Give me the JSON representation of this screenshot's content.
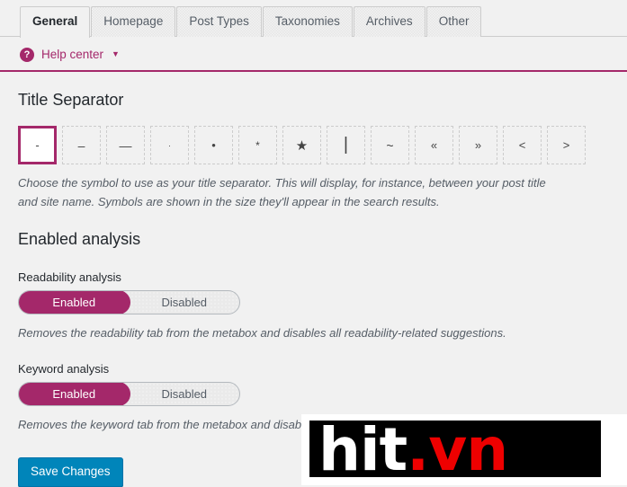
{
  "tabs": [
    {
      "label": "General",
      "active": true
    },
    {
      "label": "Homepage",
      "active": false
    },
    {
      "label": "Post Types",
      "active": false
    },
    {
      "label": "Taxonomies",
      "active": false
    },
    {
      "label": "Archives",
      "active": false
    },
    {
      "label": "Other",
      "active": false
    }
  ],
  "help": {
    "icon": "question-mark-circle-icon",
    "label": "Help center",
    "caret": "▼"
  },
  "title_separator": {
    "heading": "Title Separator",
    "options": [
      {
        "glyph": "-",
        "name": "hyphen",
        "class": "g-hyphen",
        "selected": true
      },
      {
        "glyph": "–",
        "name": "en-dash",
        "class": "g-endash",
        "selected": false
      },
      {
        "glyph": "—",
        "name": "em-dash",
        "class": "g-emdash",
        "selected": false
      },
      {
        "glyph": "·",
        "name": "middle-dot",
        "class": "g-dot",
        "selected": false
      },
      {
        "glyph": "•",
        "name": "bullet",
        "class": "g-bullet",
        "selected": false
      },
      {
        "glyph": "*",
        "name": "asterisk",
        "class": "g-star-sm",
        "selected": false
      },
      {
        "glyph": "★",
        "name": "star",
        "class": "g-star-lg",
        "selected": false
      },
      {
        "glyph": "|",
        "name": "pipe",
        "class": "g-pipe",
        "selected": false
      },
      {
        "glyph": "~",
        "name": "tilde",
        "class": "g-tilde",
        "selected": false
      },
      {
        "glyph": "«",
        "name": "double-angle-left",
        "class": "g-chev",
        "selected": false
      },
      {
        "glyph": "»",
        "name": "double-angle-right",
        "class": "g-chev",
        "selected": false
      },
      {
        "glyph": "<",
        "name": "less-than",
        "class": "g-chev",
        "selected": false
      },
      {
        "glyph": ">",
        "name": "greater-than",
        "class": "g-chev",
        "selected": false
      }
    ],
    "description": "Choose the symbol to use as your title separator. This will display, for instance, between your post title and site name. Symbols are shown in the size they'll appear in the search results."
  },
  "enabled_analysis": {
    "heading": "Enabled analysis",
    "readability": {
      "label": "Readability analysis",
      "on_label": "Enabled",
      "off_label": "Disabled",
      "value": "Enabled",
      "description": "Removes the readability tab from the metabox and disables all readability-related suggestions."
    },
    "keyword": {
      "label": "Keyword analysis",
      "on_label": "Enabled",
      "off_label": "Disabled",
      "value": "Enabled",
      "description": "Removes the keyword tab from the metabox and disable"
    }
  },
  "save_button": {
    "label": "Save Changes"
  },
  "watermark": {
    "text_white": "hit",
    "text_red": ".vn"
  },
  "colors": {
    "accent_magenta": "#a4286a",
    "button_blue": "#0085ba",
    "page_background": "#f1f1f1",
    "watermark_red": "#ee0000"
  }
}
